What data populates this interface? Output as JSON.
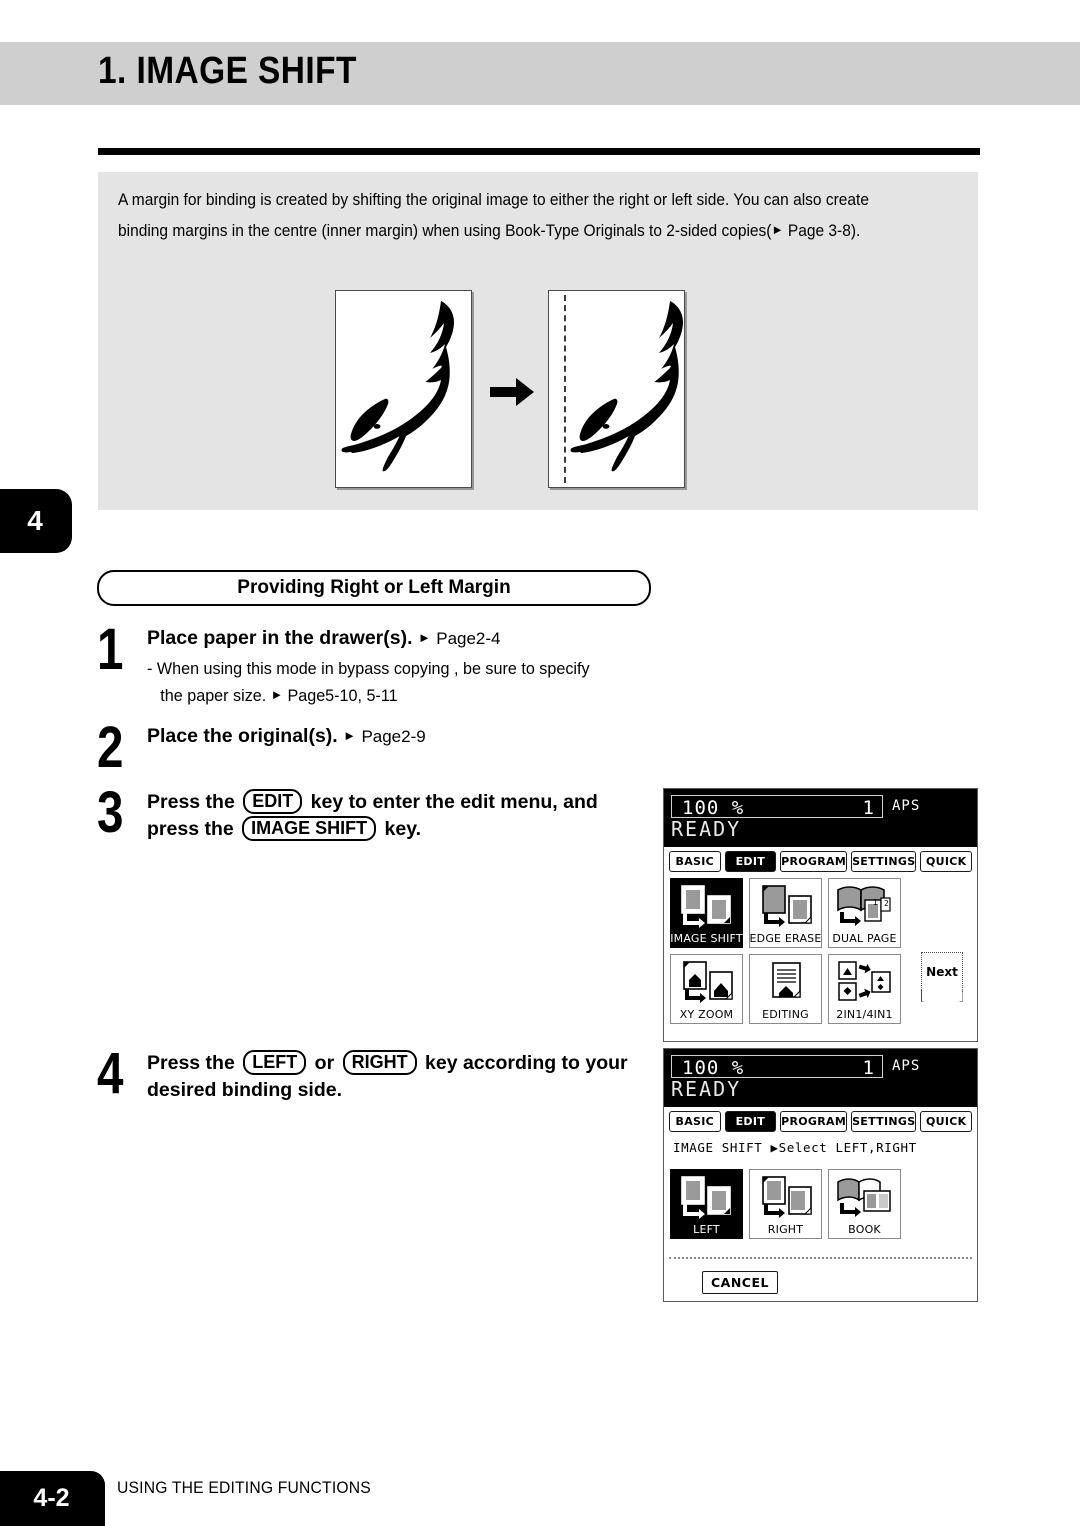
{
  "header": {
    "title": "1. IMAGE SHIFT"
  },
  "intro": {
    "paragraph": "A margin for binding is created by shifting the original image to either the right or left side. You can also create binding margins in the centre (inner margin) when using Book-Type Originals to 2-sided copies(",
    "paragraph_ref": " Page 3-8)."
  },
  "chapter_tab": {
    "number": "4"
  },
  "section": {
    "pill_title": "Providing Right or Left Margin"
  },
  "steps": [
    {
      "number": "1",
      "title": "Place paper in the drawer(s).",
      "ref": "Page2-4",
      "sub1": "- When using this mode in bypass copying , be sure to specify",
      "sub2_pre": "the paper size.",
      "sub2_ref": "Page5-10, 5-11"
    },
    {
      "number": "2",
      "title": "Place the original(s).",
      "ref": "Page2-9"
    },
    {
      "number": "3",
      "line1_a": "Press the",
      "key1": "EDIT",
      "line1_b": "key to enter the edit menu, and",
      "line2_a": "press the",
      "key2": "IMAGE SHIFT",
      "line2_b": "key."
    },
    {
      "number": "4",
      "line1_a": "Press the",
      "key1": "LEFT",
      "line1_mid": "or",
      "key2": "RIGHT",
      "line1_b": "key according to your",
      "line2": "desired binding side."
    }
  ],
  "lcd1": {
    "ratio": "100  %",
    "copies": "1",
    "paper_mode": "APS",
    "status": "READY",
    "tabs": [
      {
        "label": "BASIC",
        "selected": false
      },
      {
        "label": "EDIT",
        "selected": true
      },
      {
        "label": "PROGRAM",
        "selected": false
      },
      {
        "label": "SETTINGS",
        "selected": false
      },
      {
        "label": "QUICK",
        "selected": false
      }
    ],
    "buttons_row1": [
      {
        "label": "IMAGE SHIFT",
        "selected": true
      },
      {
        "label": "EDGE ERASE",
        "selected": false
      },
      {
        "label": "DUAL PAGE",
        "selected": false
      }
    ],
    "buttons_row2": [
      {
        "label": "XY ZOOM",
        "selected": false
      },
      {
        "label": "EDITING",
        "selected": false
      },
      {
        "label": "2IN1/4IN1",
        "selected": false
      }
    ],
    "next_label": "Next"
  },
  "lcd2": {
    "ratio": "100  %",
    "copies": "1",
    "paper_mode": "APS",
    "status": "READY",
    "tabs": [
      {
        "label": "BASIC",
        "selected": false
      },
      {
        "label": "EDIT",
        "selected": true
      },
      {
        "label": "PROGRAM",
        "selected": false
      },
      {
        "label": "SETTINGS",
        "selected": false
      },
      {
        "label": "QUICK",
        "selected": false
      }
    ],
    "prompt": "IMAGE SHIFT  ▶Select LEFT,RIGHT",
    "buttons": [
      {
        "label": "LEFT",
        "selected": true
      },
      {
        "label": "RIGHT",
        "selected": false
      },
      {
        "label": "BOOK",
        "selected": false
      }
    ],
    "cancel_label": "CANCEL"
  },
  "footer": {
    "page": "4-2",
    "text": "USING THE EDITING FUNCTIONS"
  },
  "colors": {
    "header_band": "#cfcfcf",
    "intro_panel": "#e4e4e4",
    "ink": "#000000"
  }
}
